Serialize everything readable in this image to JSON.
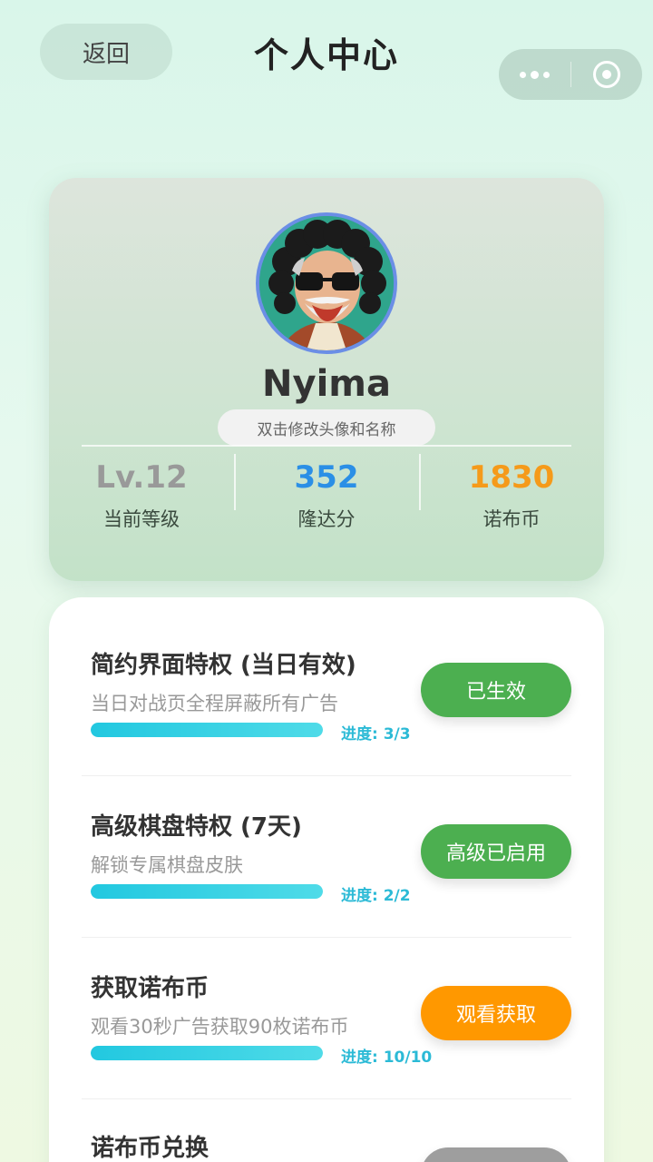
{
  "header": {
    "back_label": "返回",
    "title": "个人中心"
  },
  "profile": {
    "nickname": "Nyima",
    "edit_hint": "双击修改头像和名称",
    "stats": [
      {
        "value": "Lv.12",
        "label": "当前等级",
        "color": "#999999"
      },
      {
        "value": "352",
        "label": "隆达分",
        "color": "#2b8fe6"
      },
      {
        "value": "1830",
        "label": "诺布币",
        "color": "#f59a1a"
      }
    ]
  },
  "tasks": [
    {
      "title": "简约界面特权 (当日有效)",
      "desc": "当日对战页全程屏蔽所有广告",
      "progress_text": "进度: 3/3",
      "progress": 1.0,
      "button": "已生效",
      "button_color": "#4caf50"
    },
    {
      "title": "高级棋盘特权 (7天)",
      "desc": "解锁专属棋盘皮肤",
      "progress_text": "进度: 2/2",
      "progress": 1.0,
      "button": "高级已启用",
      "button_color": "#4caf50"
    },
    {
      "title": "获取诺布币",
      "desc": "观看30秒广告获取90枚诺布币",
      "progress_text": "进度: 10/10",
      "progress": 1.0,
      "button": "观看获取",
      "button_color": "#ff9800"
    },
    {
      "title": "诺布币兑换",
      "button_color": "#9e9e9e"
    }
  ]
}
